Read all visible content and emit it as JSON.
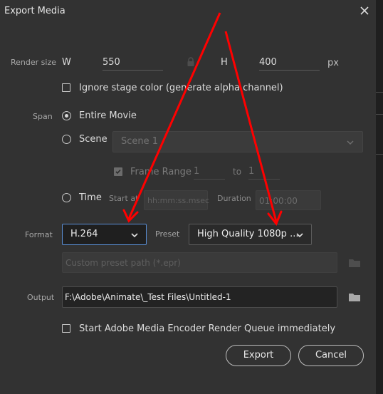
{
  "window": {
    "title": "Export Media"
  },
  "render_size": {
    "label": "Render size",
    "w_label": "W",
    "w_value": "550",
    "h_label": "H",
    "h_value": "400",
    "unit": "px"
  },
  "ignore_stage": {
    "label": "Ignore stage color (generate alpha channel)",
    "checked": false
  },
  "span": {
    "label": "Span",
    "entire_movie": "Entire Movie",
    "scene": "Scene",
    "scene_value": "Scene 1",
    "frame_range": "Frame Range",
    "frame_from": "1",
    "frame_to_label": "to",
    "frame_to": "1",
    "time": "Time",
    "start_at": "Start at",
    "start_placeholder": "hh:mm:ss.msec",
    "duration": "Duration",
    "duration_value": "01:00:00"
  },
  "format": {
    "label": "Format",
    "value": "H.264",
    "preset_label": "Preset",
    "preset_value": "High Quality 1080p ..."
  },
  "custom_preset": {
    "placeholder": "Custom preset path (*.epr)"
  },
  "output": {
    "label": "Output",
    "path": "F:\\Adobe\\Animate\\_Test Files\\Untitled-1"
  },
  "media_encoder": {
    "label": "Start Adobe Media Encoder Render Queue immediately",
    "checked": false
  },
  "buttons": {
    "export": "Export",
    "cancel": "Cancel"
  },
  "colors": {
    "background": "#323232",
    "focus": "#5a8fd6",
    "arrow": "#ff0000"
  }
}
